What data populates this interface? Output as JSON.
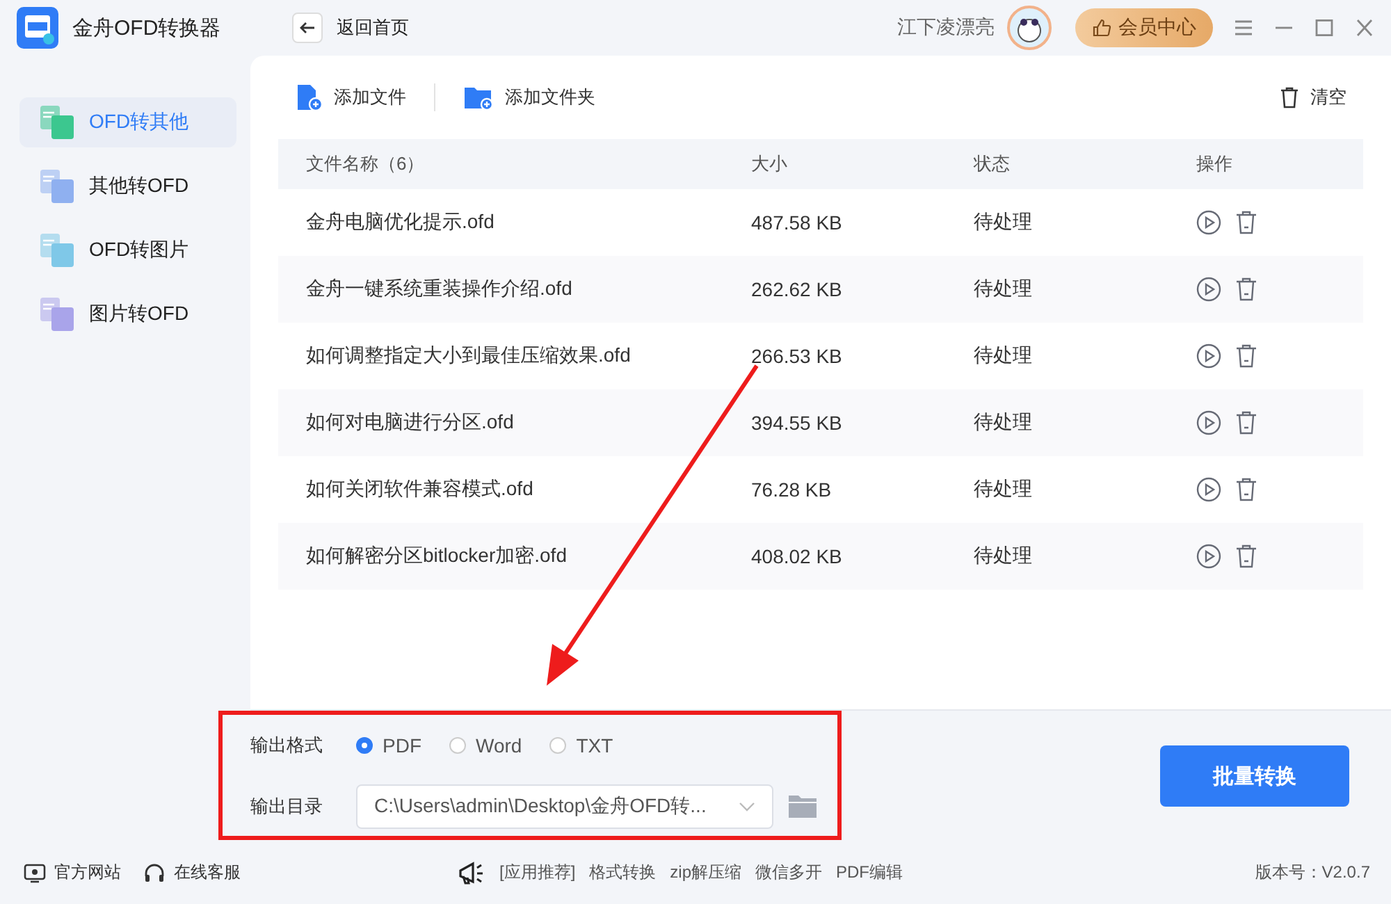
{
  "app": {
    "title": "金舟OFD转换器",
    "back": "返回首页",
    "user": "江下凌漂亮",
    "vip": "会员中心"
  },
  "sidebar": {
    "items": [
      {
        "label": "OFD转其他",
        "selected": true
      },
      {
        "label": "其他转OFD",
        "selected": false
      },
      {
        "label": "OFD转图片",
        "selected": false
      },
      {
        "label": "图片转OFD",
        "selected": false
      }
    ]
  },
  "toolbar": {
    "add_file": "添加文件",
    "add_folder": "添加文件夹",
    "clear": "清空"
  },
  "table": {
    "columns": [
      "文件名称（6）",
      "大小",
      "状态",
      "操作"
    ],
    "rows": [
      {
        "name": "金舟电脑优化提示.ofd",
        "size": "487.58 KB",
        "status": "待处理"
      },
      {
        "name": "金舟一键系统重装操作介绍.ofd",
        "size": "262.62 KB",
        "status": "待处理"
      },
      {
        "name": "如何调整指定大小到最佳压缩效果.ofd",
        "size": "266.53 KB",
        "status": "待处理"
      },
      {
        "name": "如何对电脑进行分区.ofd",
        "size": "394.55 KB",
        "status": "待处理"
      },
      {
        "name": "如何关闭软件兼容模式.ofd",
        "size": "76.28 KB",
        "status": "待处理"
      },
      {
        "name": "如何解密分区bitlocker加密.ofd",
        "size": "408.02 KB",
        "status": "待处理"
      }
    ]
  },
  "output": {
    "format_label": "输出格式",
    "formats": [
      {
        "label": "PDF",
        "selected": true
      },
      {
        "label": "Word",
        "selected": false
      },
      {
        "label": "TXT",
        "selected": false
      }
    ],
    "dir_label": "输出目录",
    "dir": "C:\\Users\\admin\\Desktop\\金舟OFD转...",
    "convert": "批量转换"
  },
  "footer": {
    "site": "官方网站",
    "support": "在线客服",
    "promo": [
      "[应用推荐]",
      "格式转换",
      "zip解压缩",
      "微信多开",
      "PDF编辑"
    ],
    "version": "版本号：V2.0.7"
  }
}
